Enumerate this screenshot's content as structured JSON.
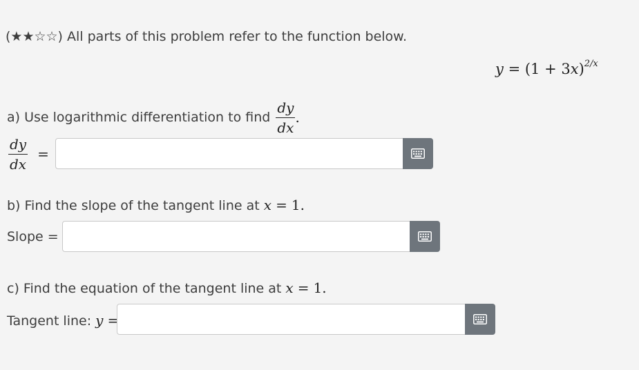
{
  "intro": {
    "rating": "(★★☆☆)",
    "text": "All parts of this problem refer to the function below."
  },
  "function": {
    "lhs": "y",
    "eq": "=",
    "open": "(1 + 3",
    "x": "x",
    "close": ")",
    "exponent": "2/x"
  },
  "part_a": {
    "prompt": "a) Use logarithmic differentiation to find",
    "frac_num": "dy",
    "frac_den": "dx",
    "period": ".",
    "answer_label_num": "dy",
    "answer_label_den": "dx",
    "answer_eq": "=",
    "answer_value": ""
  },
  "part_b": {
    "prompt": "b) Find the slope of the tangent line at",
    "var": "x",
    "eq": "=",
    "value": "1.",
    "answer_label": "Slope =",
    "answer_value": ""
  },
  "part_c": {
    "prompt": "c) Find the equation of the tangent line at",
    "var": "x",
    "eq": "=",
    "value": "1.",
    "answer_label": "Tangent line:",
    "answer_var": "y",
    "answer_eq": "=",
    "answer_value": ""
  },
  "icons": {
    "keyboard": "keyboard-icon"
  }
}
